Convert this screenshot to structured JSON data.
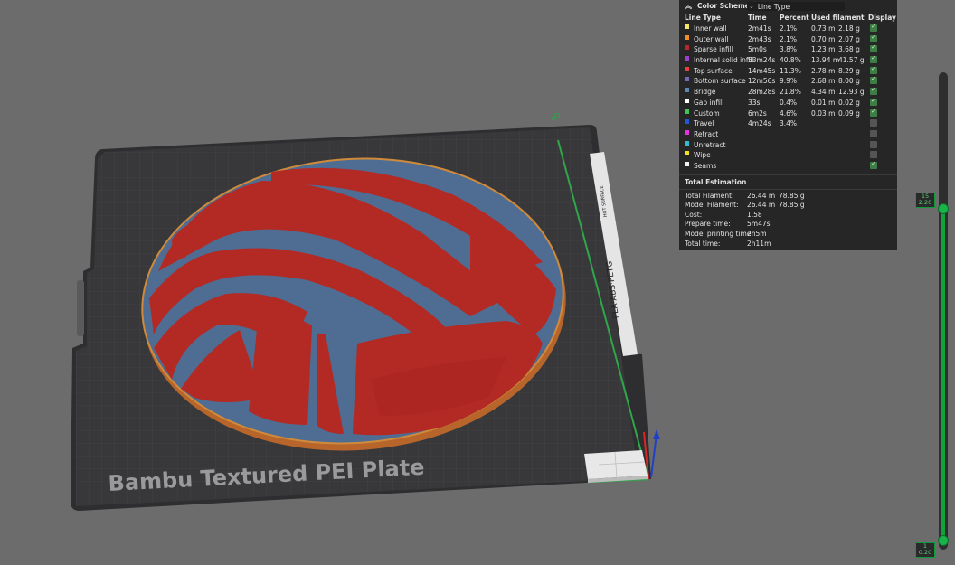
{
  "plate": {
    "name": "Bambu Textured PEI Plate",
    "side_label": "PLA·ABS·PETG",
    "side_label_small": "HOT SURFACE"
  },
  "color_scheme": {
    "title": "Color Scheme",
    "selected": "Line Type",
    "columns": {
      "line_type": "Line Type",
      "time": "Time",
      "percent": "Percent",
      "used_filament": "Used filament",
      "display": "Display"
    },
    "rows": [
      {
        "name": "Inner wall",
        "color": "#f7e66a",
        "time": "2m41s",
        "percent": "2.1%",
        "meters": "0.73 m",
        "grams": "2.18 g",
        "display": true
      },
      {
        "name": "Outer wall",
        "color": "#f28c2e",
        "time": "2m43s",
        "percent": "2.1%",
        "meters": "0.70 m",
        "grams": "2.07 g",
        "display": true
      },
      {
        "name": "Sparse infill",
        "color": "#b9262b",
        "time": "5m0s",
        "percent": "3.8%",
        "meters": "1.23 m",
        "grams": "3.68 g",
        "display": true
      },
      {
        "name": "Internal solid infill",
        "color": "#9b3fd0",
        "time": "53m24s",
        "percent": "40.8%",
        "meters": "13.94 m",
        "grams": "41.57 g",
        "display": true
      },
      {
        "name": "Top surface",
        "color": "#e8413a",
        "time": "14m45s",
        "percent": "11.3%",
        "meters": "2.78 m",
        "grams": "8.29 g",
        "display": true
      },
      {
        "name": "Bottom surface",
        "color": "#7a66b8",
        "time": "12m56s",
        "percent": "9.9%",
        "meters": "2.68 m",
        "grams": "8.00 g",
        "display": true
      },
      {
        "name": "Bridge",
        "color": "#5e86b2",
        "time": "28m28s",
        "percent": "21.8%",
        "meters": "4.34 m",
        "grams": "12.93 g",
        "display": true
      },
      {
        "name": "Gap infill",
        "color": "#ffffff",
        "time": "33s",
        "percent": "0.4%",
        "meters": "0.01 m",
        "grams": "0.02 g",
        "display": true
      },
      {
        "name": "Custom",
        "color": "#3fc35a",
        "time": "6m2s",
        "percent": "4.6%",
        "meters": "0.03 m",
        "grams": "0.09 g",
        "display": true
      },
      {
        "name": "Travel",
        "color": "#2457d6",
        "time": "4m24s",
        "percent": "3.4%",
        "meters": "",
        "grams": "",
        "display": false
      },
      {
        "name": "Retract",
        "color": "#e132e6",
        "time": "",
        "percent": "",
        "meters": "",
        "grams": "",
        "display": false
      },
      {
        "name": "Unretract",
        "color": "#38b9c9",
        "time": "",
        "percent": "",
        "meters": "",
        "grams": "",
        "display": false
      },
      {
        "name": "Wipe",
        "color": "#f5e21e",
        "time": "",
        "percent": "",
        "meters": "",
        "grams": "",
        "display": false
      },
      {
        "name": "Seams",
        "color": "#f2f2f2",
        "time": "",
        "percent": "",
        "meters": "",
        "grams": "",
        "display": true
      }
    ]
  },
  "total_estimation": {
    "title": "Total Estimation",
    "rows": [
      {
        "label": "Total Filament:",
        "a": "26.44 m",
        "b": "78.85 g"
      },
      {
        "label": "Model Filament:",
        "a": "26.44 m",
        "b": "78.85 g"
      },
      {
        "label": "Cost:",
        "a": "1.58",
        "b": ""
      },
      {
        "label": "Prepare time:",
        "a": "5m47s",
        "b": ""
      },
      {
        "label": "Model printing time:",
        "a": "2h5m",
        "b": ""
      },
      {
        "label": "Total time:",
        "a": "2h11m",
        "b": ""
      }
    ]
  },
  "layer_slider": {
    "top_layer": "15",
    "top_height": "2.20",
    "bottom_layer": "1",
    "bottom_height": "0.20"
  },
  "colors": {
    "background": "#6c6c6c",
    "plate": "#3a3a3c",
    "ball_red": "#b32a25",
    "seam_blue": "#4f6c92",
    "edge_orange": "#c57b32",
    "axis_green": "#2fa64a",
    "axis_red": "#d42727",
    "axis_blue": "#2040c8"
  }
}
